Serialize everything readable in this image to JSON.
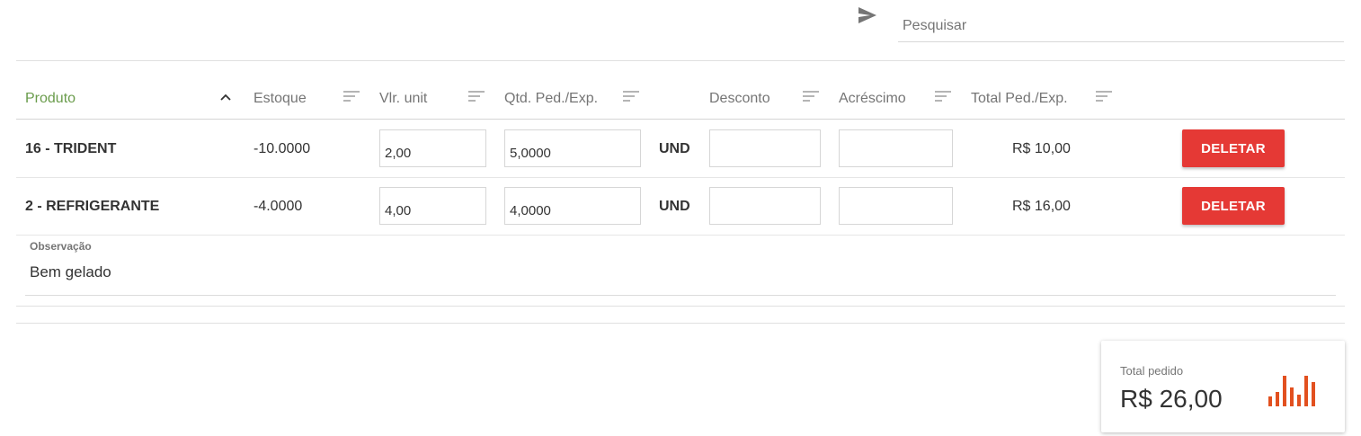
{
  "search": {
    "placeholder": "Pesquisar"
  },
  "table": {
    "headers": {
      "produto": "Produto",
      "estoque": "Estoque",
      "vlr_unit": "Vlr. unit",
      "qtd": "Qtd. Ped./Exp.",
      "desconto": "Desconto",
      "acrescimo": "Acréscimo",
      "total": "Total Ped./Exp."
    },
    "rows": [
      {
        "produto": "16 - TRIDENT",
        "estoque": "-10.0000",
        "vlr_unit": "2,00",
        "qtd": "5,0000",
        "unidade": "UND",
        "desconto": "",
        "acrescimo": "",
        "total": "R$ 10,00",
        "delete_label": "DELETAR"
      },
      {
        "produto": "2 - REFRIGERANTE",
        "estoque": "-4.0000",
        "vlr_unit": "4,00",
        "qtd": "4,0000",
        "unidade": "UND",
        "desconto": "",
        "acrescimo": "",
        "total": "R$ 16,00",
        "delete_label": "DELETAR"
      }
    ]
  },
  "observacao": {
    "label": "Observação",
    "value": "Bem gelado"
  },
  "summary": {
    "label": "Total pedido",
    "value": "R$ 26,00"
  },
  "colors": {
    "accent": "#6a9c4c",
    "danger": "#e53935",
    "chart": "#e2501f"
  },
  "icons": {
    "send": "send-icon",
    "sort": "sort-icon",
    "sort_asc": "chevron-up-icon",
    "chart": "bar-chart-icon"
  }
}
